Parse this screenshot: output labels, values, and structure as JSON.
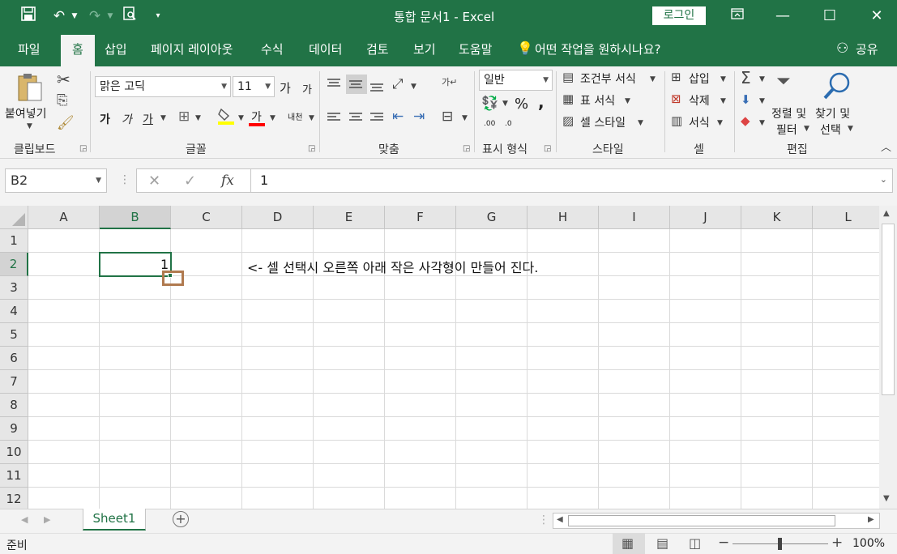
{
  "window": {
    "title": "통합 문서1  -  Excel",
    "login_label": "로그인",
    "minimize": "—",
    "maximize": "☐",
    "close": "✕"
  },
  "quick_access": {
    "save_icon": "save-icon",
    "undo_icon": "undo-icon",
    "redo_icon": "redo-icon",
    "preview_icon": "print-preview-icon"
  },
  "tabs": [
    {
      "label": "파일"
    },
    {
      "label": "홈"
    },
    {
      "label": "삽입"
    },
    {
      "label": "페이지 레이아웃"
    },
    {
      "label": "수식"
    },
    {
      "label": "데이터"
    },
    {
      "label": "검토"
    },
    {
      "label": "보기"
    },
    {
      "label": "도움말"
    }
  ],
  "tell_me": "어떤 작업을 원하시나요?",
  "share_label": "공유",
  "ribbon": {
    "clipboard": {
      "paste": "붙여넣기",
      "label": "클립보드"
    },
    "font": {
      "name": "맑은 고딕",
      "size": "11",
      "grow": "가",
      "shrink": "가",
      "bold": "가",
      "italic": "가",
      "underline": "가",
      "color": "가",
      "phonetic": "내천",
      "label": "글꼴"
    },
    "align": {
      "label": "맞춤"
    },
    "number": {
      "format": "일반",
      "percent": "%",
      "comma": ",",
      "label": "표시 형식",
      "inc": ".00",
      "dec": ".0"
    },
    "styles": {
      "conditional": "조건부 서식",
      "table": "표 서식",
      "cell": "셀 스타일",
      "label": "스타일"
    },
    "cells": {
      "insert": "삽입",
      "delete": "삭제",
      "format": "서식",
      "label": "셀"
    },
    "editing": {
      "sort1": "정렬 및",
      "sort2": "필터",
      "find1": "찾기 및",
      "find2": "선택",
      "label": "편집"
    }
  },
  "formula_bar": {
    "name_box": "B2",
    "fx": "fx",
    "value": "1"
  },
  "columns": [
    "A",
    "B",
    "C",
    "D",
    "E",
    "F",
    "G",
    "H",
    "I",
    "J",
    "K",
    "L"
  ],
  "rows": [
    "1",
    "2",
    "3",
    "4",
    "5",
    "6",
    "7",
    "8",
    "9",
    "10",
    "11",
    "12"
  ],
  "cells": {
    "B2": "1",
    "D2": "<- 셀 선택시 오른쪽 아래 작은 사각형이 만들어 진다."
  },
  "sheet_tab": "Sheet1",
  "status": {
    "ready": "준비",
    "zoom": "100%"
  },
  "colors": {
    "accent": "#217346",
    "annotation": "#b07a4f"
  }
}
